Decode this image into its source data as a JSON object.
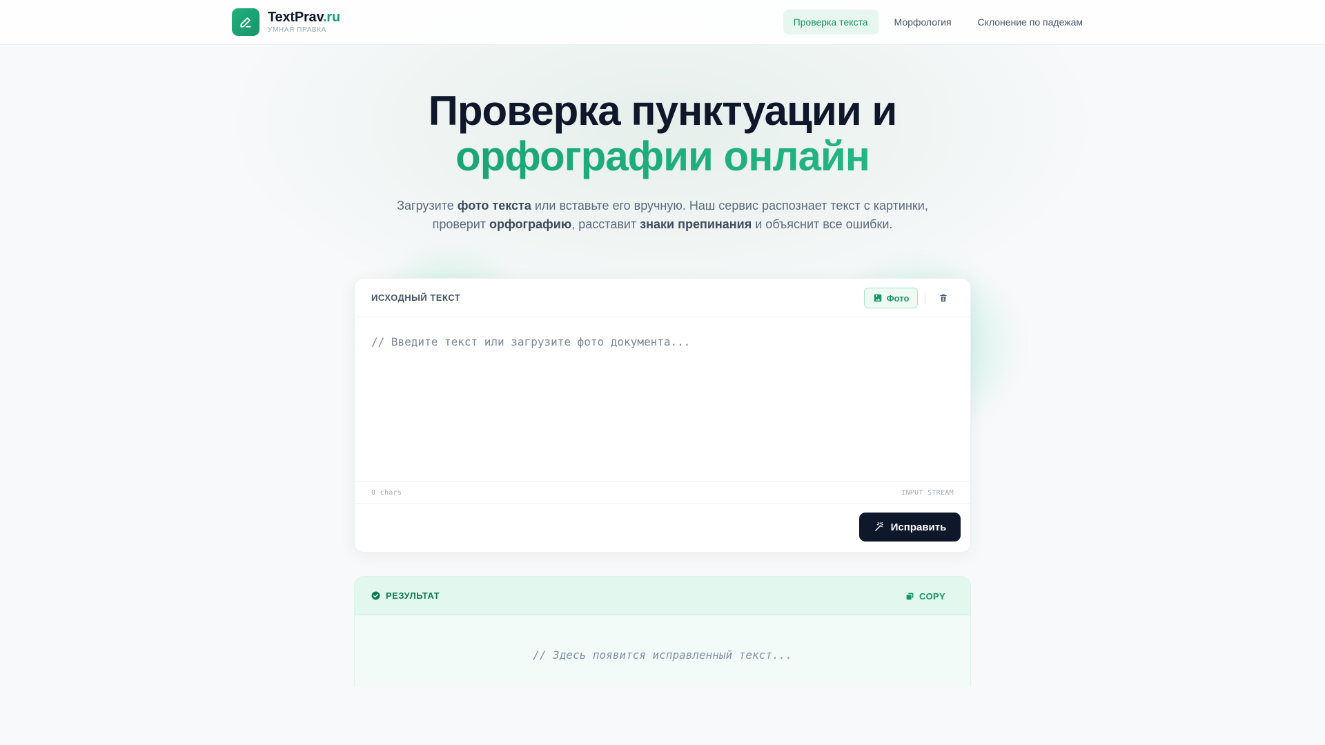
{
  "nav": {
    "brand_main": "TextPrav",
    "brand_accent": ".ru",
    "brand_sub": "УМНАЯ ПРАВКА",
    "links": [
      {
        "label": "Проверка текста",
        "active": true
      },
      {
        "label": "Морфология",
        "active": false
      },
      {
        "label": "Склонение по падежам",
        "active": false
      }
    ]
  },
  "hero": {
    "title_line1": "Проверка пунктуации и",
    "title_line2": "орфографии онлайн",
    "subtitle_parts": [
      {
        "text": "Загрузите ",
        "bold": false
      },
      {
        "text": "фото текста",
        "bold": true
      },
      {
        "text": " или вставьте его вручную. Наш сервис распознает текст с картинки, проверит ",
        "bold": false
      },
      {
        "text": "орфографию",
        "bold": true
      },
      {
        "text": ", расставит ",
        "bold": false
      },
      {
        "text": "знаки препинания",
        "bold": true
      },
      {
        "text": " и объяснит все ошибки.",
        "bold": false
      }
    ]
  },
  "input_card": {
    "label": "ИСХОДНЫЙ ТЕКСТ",
    "photo_button": "Фото",
    "placeholder": "// Введите текст или загрузите фото документа...",
    "char_count": "0 chars",
    "stream_label": "INPUT STREAM",
    "fix_button": "Исправить"
  },
  "result_card": {
    "label": "РЕЗУЛЬТАТ",
    "copy_button": "COPY",
    "placeholder": "// Здесь появится исправленный текст..."
  },
  "icons": {
    "logo": "pencil-icon",
    "photo": "image-icon",
    "trash": "trash-icon",
    "fix": "magic-wand-icon",
    "result": "check-circle-icon",
    "copy": "copy-icon"
  },
  "colors": {
    "accent": "#16a071",
    "dark": "#0f172a",
    "result_bg": "#e2f7ed"
  }
}
